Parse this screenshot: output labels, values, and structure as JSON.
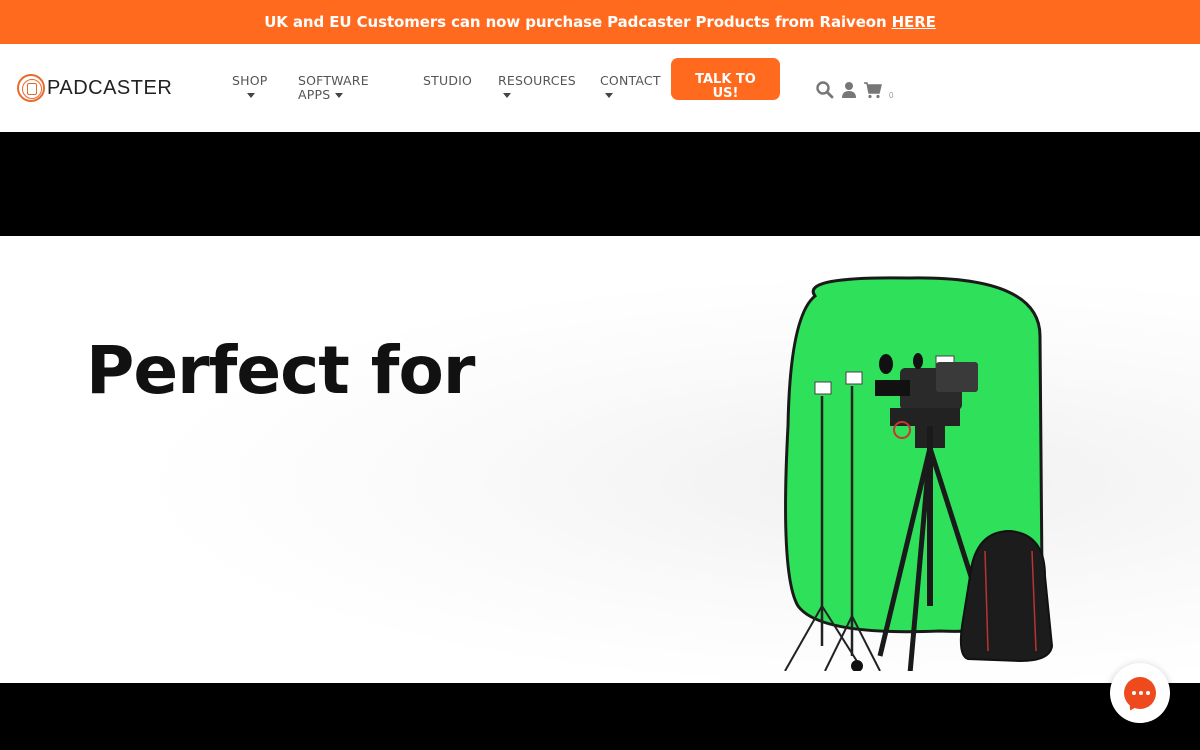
{
  "promo": {
    "text": "UK and EU Customers can now purchase Padcaster Products from Raiveon",
    "link": "HERE"
  },
  "header": {
    "logo": "PADCASTER",
    "nav": {
      "shop": "SHOP",
      "software_line1": "SOFTWARE",
      "software_line2": "APPS",
      "studio": "STUDIO",
      "resources": "RESOURCES",
      "contact": "CONTACT"
    },
    "cta_line1": "TALK TO",
    "cta_line2": "US!",
    "cart_count": "0"
  },
  "hero": {
    "title": "Perfect for"
  },
  "colors": {
    "brand": "#ff6a1f",
    "green_screen": "#2ee05a",
    "chat": "#ee4a1d"
  },
  "icons": [
    "search-icon",
    "user-icon",
    "cart-icon",
    "chat-icon"
  ]
}
